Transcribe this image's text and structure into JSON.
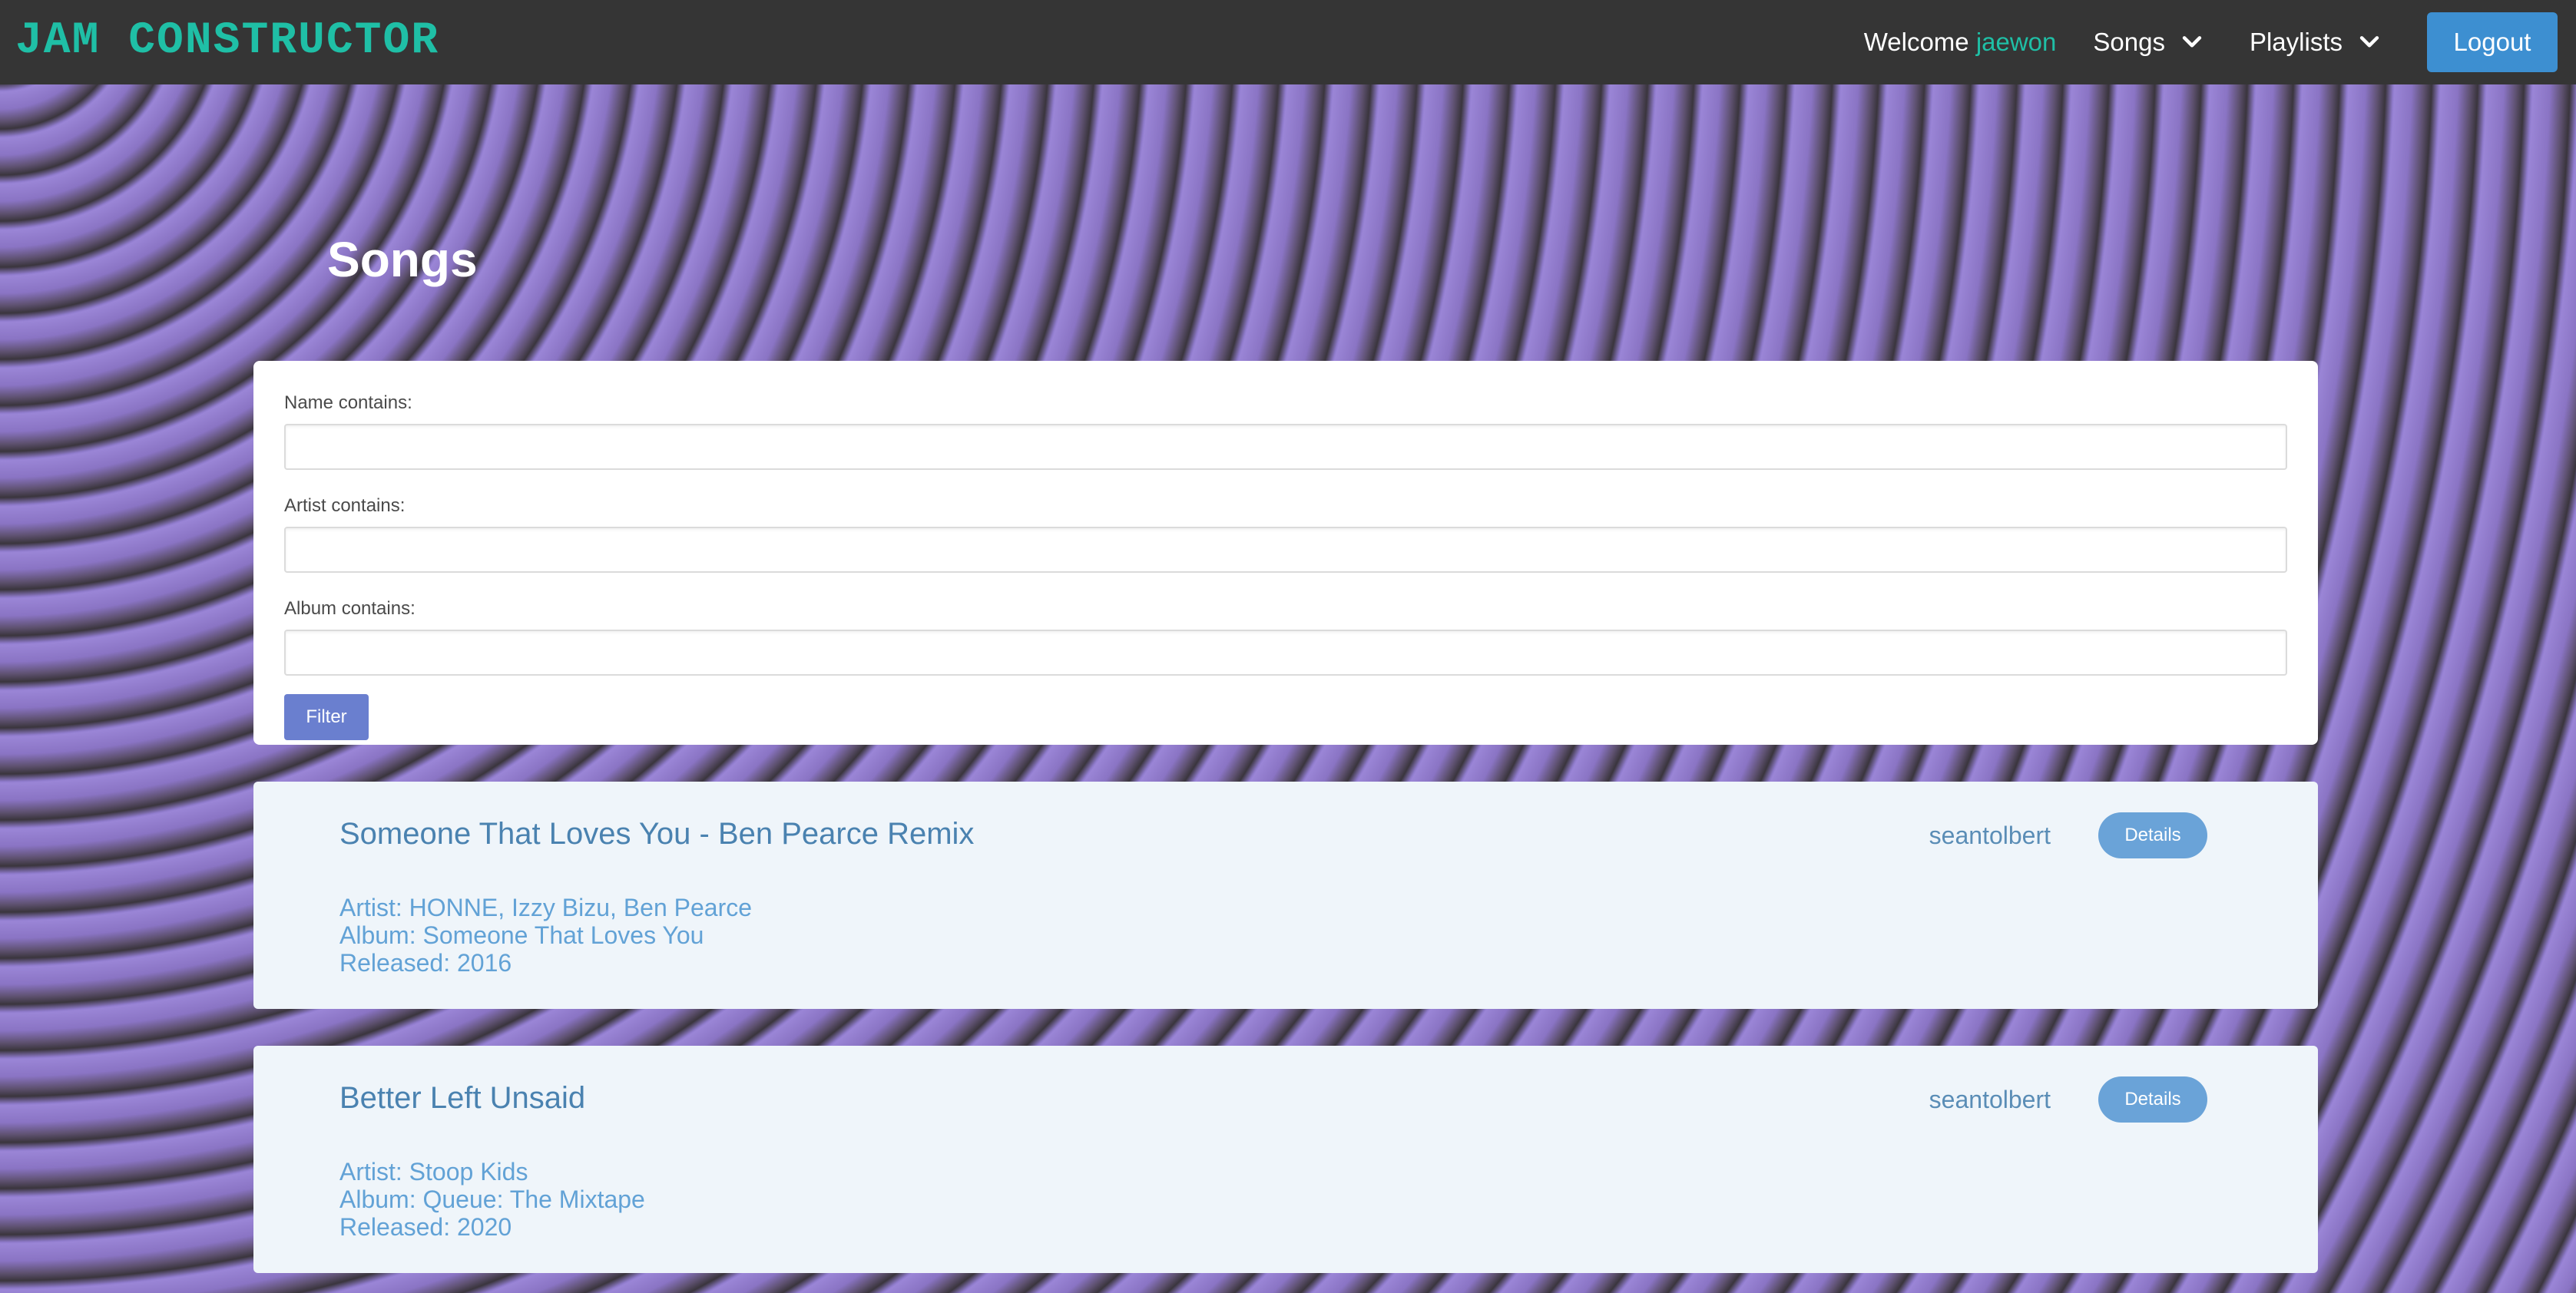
{
  "navbar": {
    "brand": "JAM CONSTRUCTOR",
    "welcome_prefix": "Welcome",
    "username": "jaewon",
    "songs_menu": "Songs",
    "playlists_menu": "Playlists",
    "logout_label": "Logout"
  },
  "page": {
    "title": "Songs"
  },
  "filter": {
    "name_label": "Name contains:",
    "name_value": "",
    "artist_label": "Artist contains:",
    "artist_value": "",
    "album_label": "Album contains:",
    "album_value": "",
    "button_label": "Filter"
  },
  "songs": [
    {
      "title": "Someone That Loves You - Ben Pearce Remix",
      "artist": "Artist: HONNE, Izzy Bizu, Ben Pearce",
      "album": "Album: Someone That Loves You",
      "released": "Released: 2016",
      "owner": "seantolbert",
      "details_label": "Details"
    },
    {
      "title": "Better Left Unsaid",
      "artist": "Artist: Stoop Kids",
      "album": "Album: Queue: The Mixtape",
      "released": "Released: 2020",
      "owner": "seantolbert",
      "details_label": "Details"
    }
  ],
  "colors": {
    "navbar_bg": "#353535",
    "brand": "#1fbfa6",
    "logout_button": "#3d8fd1",
    "filter_button": "#6a7fcf",
    "details_button": "#6aa3d8",
    "card_bg": "#eff5fa"
  }
}
